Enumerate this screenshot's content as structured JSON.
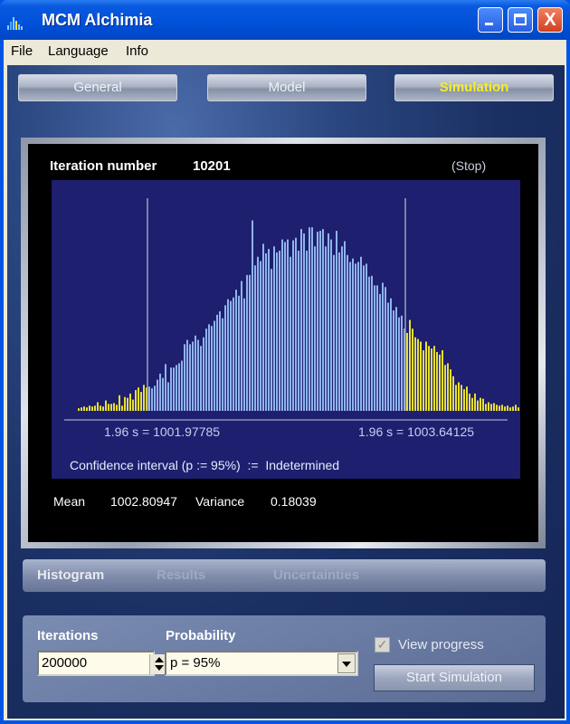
{
  "window": {
    "title": "MCM Alchimia",
    "app_icon": "bars-chart-icon",
    "controls": {
      "minimize": "minimize-icon",
      "maximize": "maximize-icon",
      "close": "close-icon",
      "close_glyph": "X"
    }
  },
  "menu": {
    "items": [
      {
        "label": "File"
      },
      {
        "label": "Language"
      },
      {
        "label": "Info"
      }
    ]
  },
  "nav": {
    "tabs": [
      {
        "label": "General",
        "active": false
      },
      {
        "label": "Model",
        "active": false
      },
      {
        "label": "Simulation",
        "active": true
      }
    ],
    "active_color": "#f5ee2a"
  },
  "simulation": {
    "iteration_label": "Iteration number",
    "iteration_value": "10201",
    "stop_label": "(Stop)",
    "lower_bound_label": "1.96 s = 1001.97785",
    "upper_bound_label": "1.96 s = 1003.64125",
    "confidence_text": "Confidence interval (p := 95%)  :=  Indetermined",
    "mean_label": "Mean",
    "mean_value": "1002.80947",
    "variance_label": "Variance",
    "variance_value": "0.18039"
  },
  "subtabs": {
    "items": [
      {
        "label": "Histogram",
        "active": true
      },
      {
        "label": "Results",
        "active": false
      },
      {
        "label": "Uncertainties",
        "active": false
      }
    ]
  },
  "controls": {
    "iterations_label": "Iterations",
    "iterations_value": "200000",
    "probability_label": "Probability",
    "probability_value": "p = 95%",
    "view_progress_label": "View progress",
    "view_progress_checked": true,
    "check_glyph": "✓",
    "start_button_label": "Start Simulation"
  },
  "chart_data": {
    "type": "bar",
    "title": "",
    "xlabel": "",
    "ylabel": "",
    "grid": false,
    "bar_color": "#8fb4ec",
    "tail_color": "#e8e030",
    "bound_line_color": "#9aa0c0",
    "lower_bound": 1001.97785,
    "upper_bound": 1003.64125,
    "lower_bound_bin": 26,
    "upper_bound_bin": 120,
    "ylim": [
      0,
      230
    ],
    "values": [
      3,
      4,
      5,
      4,
      6,
      5,
      6,
      10,
      6,
      5,
      12,
      8,
      8,
      9,
      7,
      18,
      6,
      16,
      15,
      20,
      13,
      24,
      27,
      22,
      30,
      27,
      28,
      26,
      29,
      36,
      43,
      38,
      54,
      33,
      50,
      50,
      53,
      55,
      58,
      77,
      82,
      77,
      80,
      87,
      82,
      75,
      85,
      95,
      100,
      98,
      104,
      111,
      115,
      107,
      122,
      129,
      127,
      131,
      140,
      133,
      150,
      130,
      157,
      157,
      220,
      168,
      178,
      173,
      193,
      182,
      187,
      164,
      190,
      183,
      185,
      198,
      195,
      198,
      178,
      197,
      200,
      185,
      210,
      205,
      185,
      212,
      212,
      190,
      207,
      208,
      210,
      190,
      205,
      198,
      180,
      208,
      183,
      190,
      196,
      180,
      172,
      176,
      170,
      172,
      178,
      168,
      170,
      155,
      156,
      145,
      145,
      135,
      148,
      143,
      125,
      130,
      116,
      120,
      108,
      110,
      95,
      90,
      105,
      95,
      85,
      83,
      80,
      70,
      80,
      75,
      72,
      75,
      68,
      65,
      70,
      53,
      55,
      48,
      40,
      30,
      33,
      30,
      25,
      28,
      20,
      15,
      20,
      12,
      15,
      14,
      8,
      10,
      8,
      9,
      7,
      6,
      7,
      5,
      6,
      4,
      5,
      7,
      4,
      6,
      5,
      3
    ]
  }
}
